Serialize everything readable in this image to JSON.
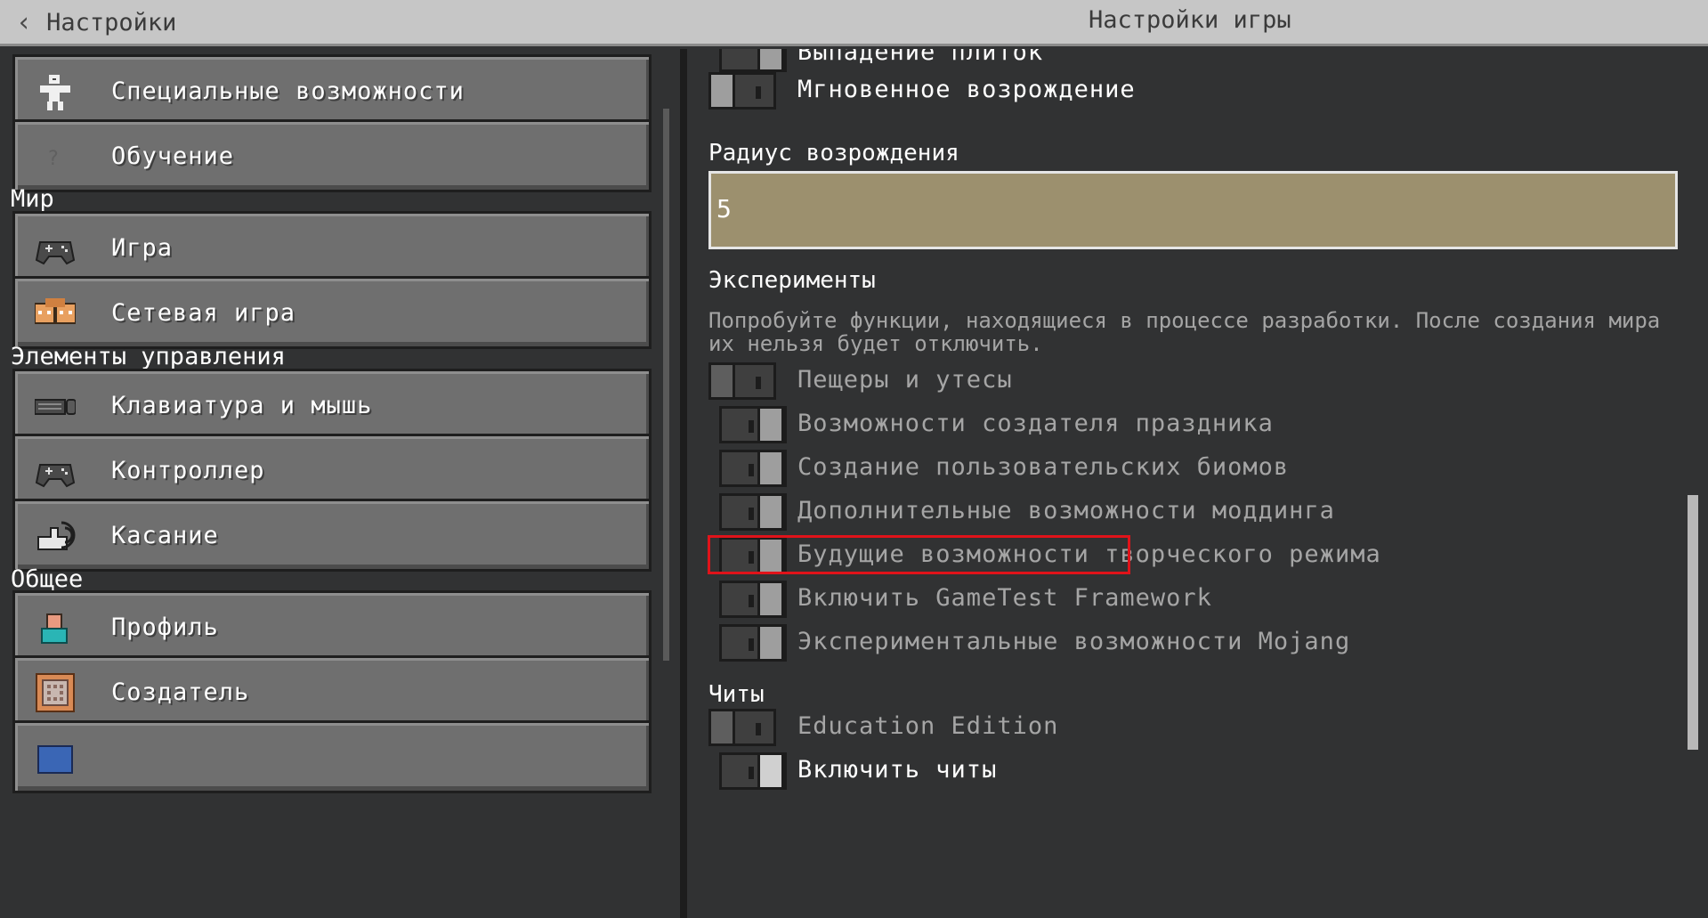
{
  "header": {
    "back_label": "Настройки",
    "title": "Настройки игры"
  },
  "sidebar": {
    "buttons": [
      {
        "label": "Специальные возможности",
        "icon": "accessibility-icon"
      },
      {
        "label": "Обучение",
        "icon": "help-icon"
      },
      {
        "label": "Игра",
        "icon": "gamepad-icon"
      },
      {
        "label": "Сетевая игра",
        "icon": "multiplayer-icon"
      },
      {
        "label": "Клавиатура и мышь",
        "icon": "keyboard-mouse-icon"
      },
      {
        "label": "Контроллер",
        "icon": "controller-icon"
      },
      {
        "label": "Касание",
        "icon": "touch-icon"
      },
      {
        "label": "Профиль",
        "icon": "profile-icon"
      },
      {
        "label": "Создатель",
        "icon": "creator-icon"
      }
    ],
    "sections": {
      "world": "Мир",
      "controls": "Элементы управления",
      "general": "Общее"
    }
  },
  "content": {
    "top_partial_label": "Выпадение плиток",
    "instant_respawn": "Мгновенное возрождение",
    "spawn_radius_label": "Радиус возрождения",
    "spawn_radius_value": "5",
    "experiments_heading": "Эксперименты",
    "experiments_desc": "Попробуйте функции, находящиеся в процессе разработки. После создания мира их нельзя будет отключить.",
    "experiments": [
      {
        "label": "Пещеры и утесы",
        "state": "off"
      },
      {
        "label": "Возможности создателя праздника",
        "state": "off"
      },
      {
        "label": "Создание пользовательских биомов",
        "state": "off"
      },
      {
        "label": "Дополнительные возможности моддинга",
        "state": "off"
      },
      {
        "label": "Будущие возможности творческого режима",
        "state": "off"
      },
      {
        "label": "Включить GameTest Framework",
        "state": "off"
      },
      {
        "label": "Экспериментальные возможности Mojang",
        "state": "off"
      }
    ],
    "cheats_heading": "Читы",
    "education_edition": "Education Edition",
    "enable_cheats": "Включить читы"
  },
  "colors": {
    "highlight": "#e0131a",
    "input_bg": "#9c906e",
    "panel_bg": "#313233"
  }
}
